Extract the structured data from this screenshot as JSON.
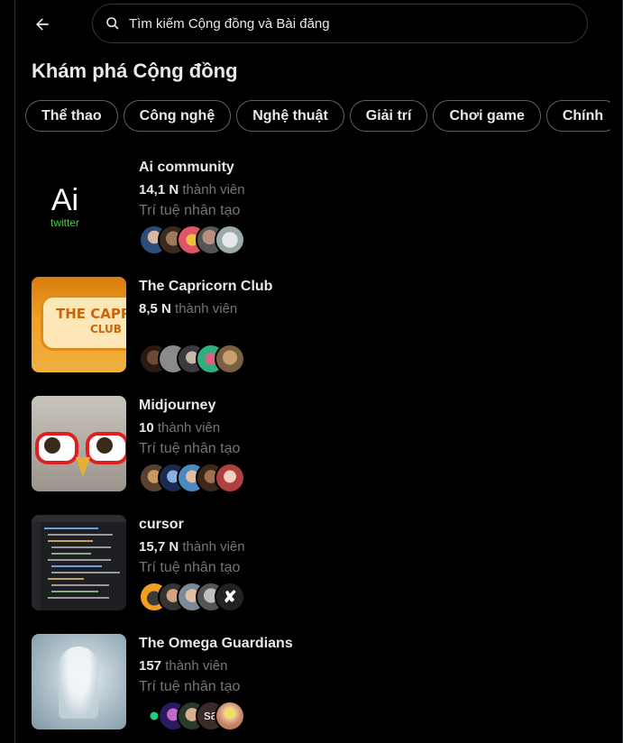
{
  "search": {
    "placeholder": "Tìm kiếm Cộng đồng và Bài đăng"
  },
  "page_title": "Khám phá Cộng đồng",
  "categories": [
    "Thể thao",
    "Công nghệ",
    "Nghệ thuật",
    "Giải trí",
    "Chơi game",
    "Chính"
  ],
  "communities": [
    {
      "name": "Ai community",
      "count": "14,1 N",
      "members_suffix": "thành viên",
      "topic": "Trí tuệ nhân tạo",
      "logo_text": "Ai",
      "logo_sub": "twitter"
    },
    {
      "name": "The Capricorn Club",
      "count": "8,5 N",
      "members_suffix": "thành viên",
      "topic": "",
      "banner_line1": "THE CAPR",
      "banner_line2": "CLUB"
    },
    {
      "name": "Midjourney",
      "count": "10",
      "members_suffix": "thành viên",
      "topic": "Trí tuệ nhân tạo"
    },
    {
      "name": "cursor",
      "count": "15,7 N",
      "members_suffix": "thành viên",
      "topic": "Trí tuệ nhân tạo"
    },
    {
      "name": "The Omega Guardians",
      "count": "157",
      "members_suffix": "thành viên",
      "topic": "Trí tuệ nhân tạo",
      "avatar_text": "sa"
    }
  ],
  "colors": {
    "background": "#000000",
    "text": "#e7e9ea",
    "secondary": "#71767b",
    "border": "#2f3336"
  }
}
